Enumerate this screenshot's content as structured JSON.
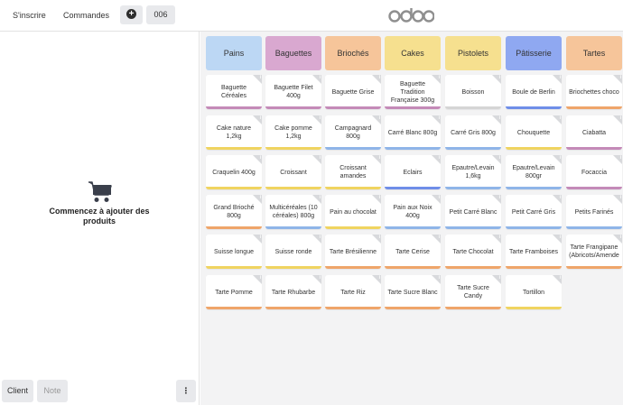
{
  "topbar": {
    "signin_label": "S'inscrire",
    "orders_label": "Commandes",
    "order_number": "006",
    "logo_text": "odoo"
  },
  "cart": {
    "empty_message": "Commencez à ajouter des produits",
    "client_label": "Client",
    "note_label": "Note",
    "more_label": "⋮"
  },
  "categories": [
    {
      "label": "Pains",
      "color": "#bcd7f4"
    },
    {
      "label": "Baguettes",
      "color": "#d9a8d0"
    },
    {
      "label": "Briochés",
      "color": "#f6c59a"
    },
    {
      "label": "Cakes",
      "color": "#f6e08f"
    },
    {
      "label": "Pistolets",
      "color": "#f6e08f"
    },
    {
      "label": "Pâtisserie",
      "color": "#8fa8f1"
    },
    {
      "label": "Tartes",
      "color": "#f6c59a"
    }
  ],
  "products": [
    [
      {
        "name": "Baguette Céréales",
        "bar": "#c48ab8"
      },
      {
        "name": "Baguette Filet 400g",
        "bar": "#c48ab8"
      },
      {
        "name": "Baguette Grise",
        "bar": "#c48ab8"
      },
      {
        "name": "Baguette Tradition Française 300g",
        "bar": "#c48ab8"
      },
      {
        "name": "Boisson",
        "bar": "#d5d5d5"
      },
      {
        "name": "Boule de Berlin",
        "bar": "#6f8ee8"
      },
      {
        "name": "Briochettes choco",
        "bar": "#efa56a"
      }
    ],
    [
      {
        "name": "Cake nature 1,2kg",
        "bar": "#f0d460"
      },
      {
        "name": "Cake pomme 1,2kg",
        "bar": "#f0d460"
      },
      {
        "name": "Campagnard 800g",
        "bar": "#8fb5e8"
      },
      {
        "name": "Carré Blanc 800g",
        "bar": "#8fb5e8"
      },
      {
        "name": "Carré Gris 800g",
        "bar": "#8fb5e8"
      },
      {
        "name": "Chouquette",
        "bar": "#f0d460"
      },
      {
        "name": "Ciabatta",
        "bar": "#c48ab8"
      }
    ],
    [
      {
        "name": "Craquelin 400g",
        "bar": "#f0d460"
      },
      {
        "name": "Croissant",
        "bar": "#f0d460"
      },
      {
        "name": "Croissant amandes",
        "bar": "#f0d460"
      },
      {
        "name": "Eclairs",
        "bar": "#6f8ee8"
      },
      {
        "name": "Epautre/Levain 1,6kg",
        "bar": "#8fb5e8"
      },
      {
        "name": "Epautre/Levain 800gr",
        "bar": "#8fb5e8"
      },
      {
        "name": "Focaccia",
        "bar": "#c48ab8"
      }
    ],
    [
      {
        "name": "Grand Brioché 800g",
        "bar": "#efa56a"
      },
      {
        "name": "Multicéréales (10 céréales) 800g",
        "bar": "#8fb5e8"
      },
      {
        "name": "Pain au chocolat",
        "bar": "#f0d460"
      },
      {
        "name": "Pain aux Noix 400g",
        "bar": "#8fb5e8"
      },
      {
        "name": "Petit Carré Blanc",
        "bar": "#8fb5e8"
      },
      {
        "name": "Petit Carré Gris",
        "bar": "#8fb5e8"
      },
      {
        "name": "Petits Farinés",
        "bar": "#8fb5e8"
      }
    ],
    [
      {
        "name": "Suisse longue",
        "bar": "#f0d460"
      },
      {
        "name": "Suisse ronde",
        "bar": "#f0d460"
      },
      {
        "name": "Tarte Brésilienne",
        "bar": "#efa56a"
      },
      {
        "name": "Tarte Cerise",
        "bar": "#efa56a"
      },
      {
        "name": "Tarte Chocolat",
        "bar": "#efa56a"
      },
      {
        "name": "Tarte Framboises",
        "bar": "#efa56a"
      },
      {
        "name": "Tarte Frangipane (Abricots/Amende",
        "bar": "#efa56a"
      }
    ],
    [
      {
        "name": "Tarte Pomme",
        "bar": "#efa56a"
      },
      {
        "name": "Tarte Rhubarbe",
        "bar": "#efa56a"
      },
      {
        "name": "Tarte Riz",
        "bar": "#efa56a"
      },
      {
        "name": "Tarte Sucre Blanc",
        "bar": "#efa56a"
      },
      {
        "name": "Tarte Sucre Candy",
        "bar": "#efa56a"
      },
      {
        "name": "Tortillon",
        "bar": "#f0d460"
      }
    ]
  ]
}
